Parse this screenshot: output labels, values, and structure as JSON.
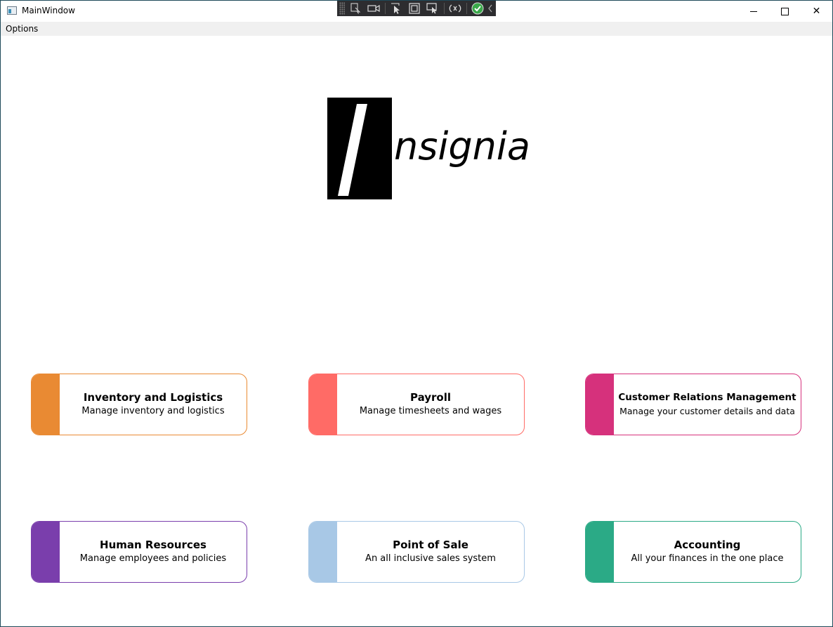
{
  "window": {
    "title": "MainWindow",
    "minimize_glyph": "",
    "maximize_glyph": "",
    "close_glyph": "✕"
  },
  "menu": {
    "items": [
      {
        "label": "Options"
      }
    ]
  },
  "debug_toolbar": {
    "icons": [
      "select-element-icon",
      "video-icon",
      "select-pointer-icon",
      "layout-adorner-icon",
      "track-focus-icon",
      "hot-reload-icon",
      "binding-check-icon",
      "collapse-icon"
    ]
  },
  "logo": {
    "letter": "I",
    "text": "nsignia"
  },
  "cards": [
    {
      "title": "Inventory and Logistics",
      "subtitle": "Manage inventory and logistics",
      "color": "#e98a33"
    },
    {
      "title": "Payroll",
      "subtitle": "Manage timesheets and wages",
      "color": "#ff6b66"
    },
    {
      "title": "Customer Relations Management",
      "subtitle": "Manage your customer details and data",
      "color": "#d6317c"
    },
    {
      "title": "Human Resources",
      "subtitle": "Manage employees and policies",
      "color": "#7a3eac"
    },
    {
      "title": "Point of Sale",
      "subtitle": "An all inclusive sales system",
      "color": "#a8c8e6"
    },
    {
      "title": "Accounting",
      "subtitle": "All your finances in the one place",
      "color": "#2baa86"
    }
  ]
}
